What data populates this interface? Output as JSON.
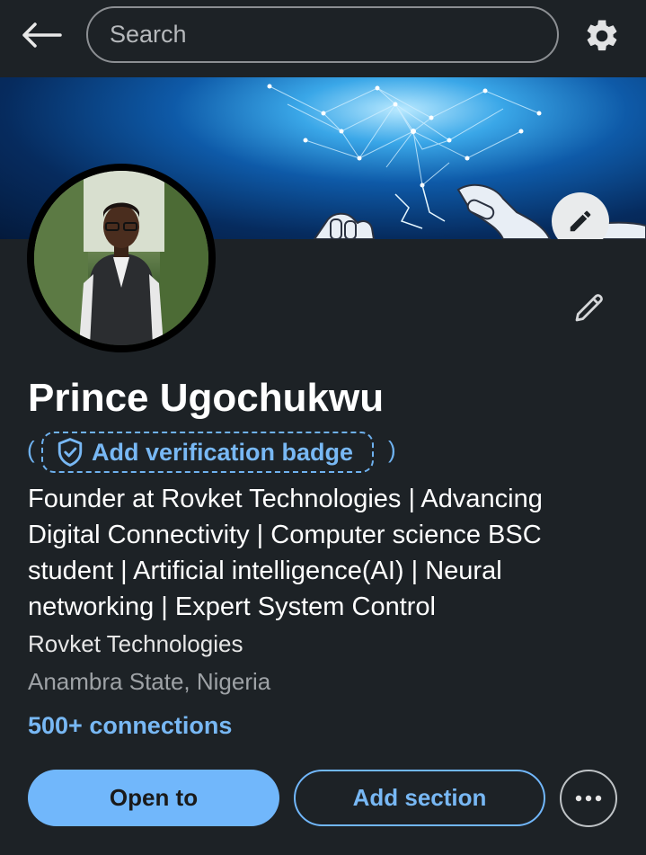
{
  "topbar": {
    "back_icon": "arrow-left-icon",
    "search_placeholder": "Search",
    "settings_icon": "gear-icon"
  },
  "banner": {
    "edit_icon": "pencil-icon"
  },
  "profile": {
    "name": "Prince Ugochukwu",
    "verification_label": "Add verification badge",
    "headline": "Founder at Rovket Technologies | Advancing\nDigital Connectivity |  Computer science BSC\nstudent | Artificial intelligence(AI)  | Neural\nnetworking | Expert System Control",
    "company": "Rovket Technologies",
    "location": "Anambra State, Nigeria",
    "connections": "500+ connections"
  },
  "actions": {
    "open_to": "Open to",
    "add_section": "Add section",
    "more_icon": "ellipsis-icon"
  },
  "colors": {
    "background": "#1d2226",
    "accent": "#71b7fb",
    "link": "#78b8f4"
  }
}
